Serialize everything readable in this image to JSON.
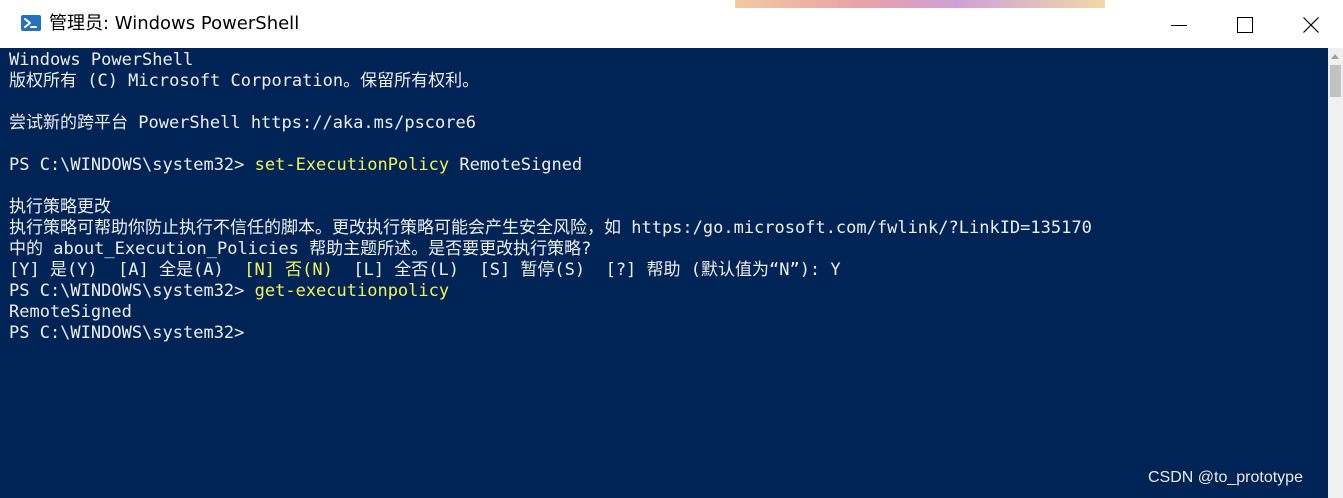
{
  "window": {
    "title": "管理员: Windows PowerShell",
    "icon": "powershell-icon",
    "controls": [
      "minimize-icon",
      "maximize-icon",
      "close-icon"
    ]
  },
  "colors": {
    "console_background": "#012456",
    "console_text": "#eeedf0",
    "command_text": "#f2f257",
    "titlebar_background": "#ffffff"
  },
  "console": {
    "lines": [
      "Windows PowerShell",
      "版权所有 (C) Microsoft Corporation。保留所有权利。",
      "尝试新的跨平台 PowerShell https://aka.ms/pscore6",
      "执行策略更改",
      "执行策略可帮助你防止执行不信任的脚本。更改执行策略可能会产生安全风险，如 https:/go.microsoft.com/fwlink/?LinkID=135170",
      "中的 about_Execution_Policies 帮助主题所述。是否要更改执行策略?",
      "RemoteSigned"
    ],
    "prompt": "PS C:\\WINDOWS\\system32>",
    "commands": [
      {
        "cmdlet": " set-ExecutionPolicy",
        "args": " RemoteSigned"
      },
      {
        "cmdlet": " get-executionpolicy",
        "args": ""
      }
    ],
    "choice_line": {
      "part1": "[Y] 是(Y)  [A] 全是(A)  ",
      "default_option": "[N] 否(N)",
      "part2": "  [L] 全否(L)  [S] 暂停(S)  [?] 帮助 (默认值为“N”): Y"
    }
  },
  "watermark": "CSDN @to_prototype"
}
